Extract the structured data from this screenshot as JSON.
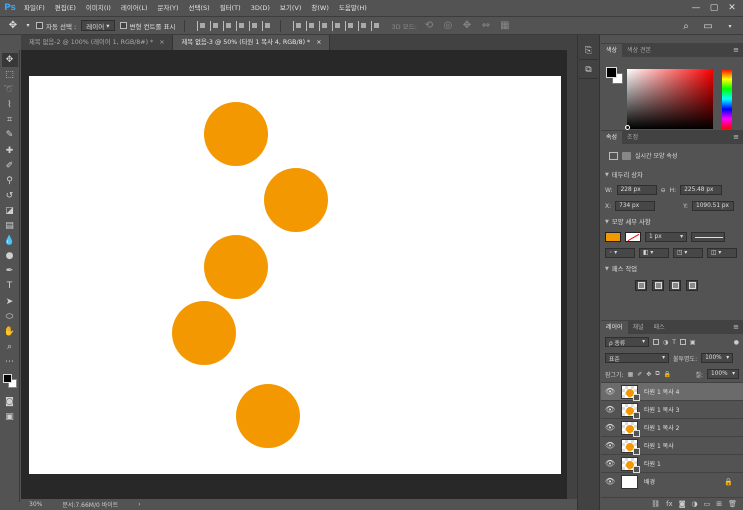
{
  "app": {
    "logo": "Ps",
    "accent": "#31a8ff"
  },
  "menu": [
    "파일(F)",
    "편집(E)",
    "이미지(I)",
    "레이어(L)",
    "문자(Y)",
    "선택(S)",
    "필터(T)",
    "3D(D)",
    "보기(V)",
    "창(W)",
    "도움말(H)"
  ],
  "window_controls": {
    "minimize": "—",
    "restore": "▢",
    "close": "✕"
  },
  "options": {
    "auto_select_label": "자동 선택 :",
    "auto_select_value": "레이어",
    "transform_label": "변형 컨트롤 표시",
    "mode_3d_label": "3D 모드:"
  },
  "tabs": [
    {
      "title": "제목 없음-2 @ 100% (레이어 1, RGB/8#) *",
      "close": "×"
    },
    {
      "title": "제목 없음-3 @ 50% (타원 1 복사 4, RGB/8) *",
      "close": "×"
    }
  ],
  "canvas": {
    "shape_color": "#f39801",
    "circle_count": 5
  },
  "status": {
    "zoom": "30%",
    "doc": "문서:7.66M/0 바이트",
    "arrow": "›"
  },
  "color_panel": {
    "tabs": [
      "색상",
      "색상 견본"
    ]
  },
  "props_panel": {
    "tabs": [
      "속성",
      "조정"
    ],
    "header": "실시간 모양 속성",
    "bounding_box": "테두리 상자",
    "w_label": "W:",
    "w_value": "228 px",
    "h_label": "H:",
    "h_value": "225.48 px",
    "x_label": "X:",
    "x_value": "734 px",
    "y_label": "Y:",
    "y_value": "1090.51 px",
    "shape_detail": "모양 세부 사항",
    "stroke_width": "1 px",
    "pathfinder": "패스 작업"
  },
  "layers_panel": {
    "tabs": [
      "레이어",
      "채널",
      "패스"
    ],
    "filter_kind": "ρ 종류",
    "blend_mode": "표준",
    "opacity_label": "불투명도:",
    "opacity_value": "100%",
    "lock_label": "잠그기:",
    "fill_label": "칠:",
    "fill_value": "100%",
    "layers": [
      {
        "name": "타원 1 복사 4",
        "selected": true,
        "type": "shape"
      },
      {
        "name": "타원 1 복사 3",
        "selected": false,
        "type": "shape"
      },
      {
        "name": "타원 1 복사 2",
        "selected": false,
        "type": "shape"
      },
      {
        "name": "타원 1 복사",
        "selected": false,
        "type": "shape"
      },
      {
        "name": "타원 1",
        "selected": false,
        "type": "shape"
      },
      {
        "name": "배경",
        "selected": false,
        "type": "background"
      }
    ]
  }
}
